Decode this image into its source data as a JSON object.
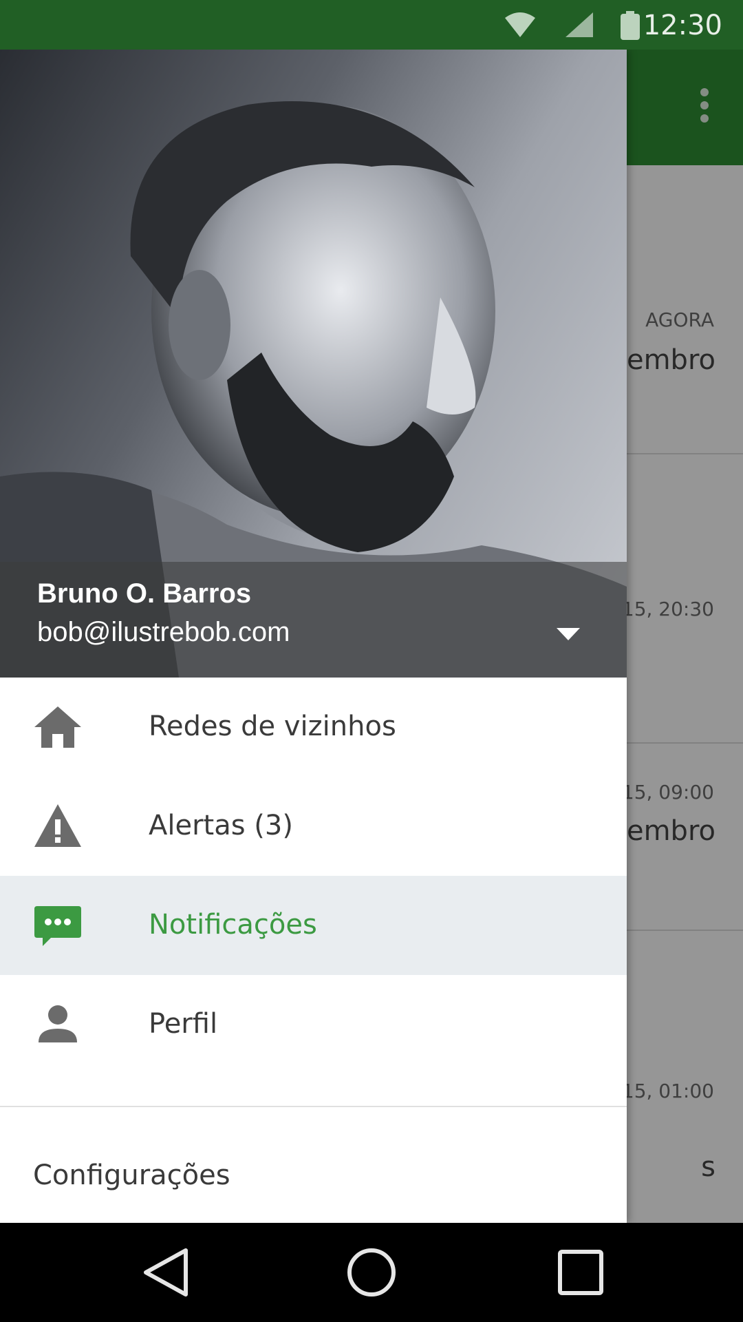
{
  "status_bar": {
    "time": "12:30",
    "icons": [
      "wifi-icon",
      "cell-signal-icon",
      "battery-icon"
    ]
  },
  "app": {
    "toolbar": {
      "menu_icon": "more-vert-icon"
    },
    "rows": [
      {
        "stamp": "AGORA",
        "line": "embro"
      },
      {
        "stamp": "15, 20:30",
        "line": ""
      },
      {
        "stamp": "15, 09:00",
        "line": "embro"
      },
      {
        "stamp": "15, 01:00",
        "line": "s"
      }
    ]
  },
  "drawer": {
    "user": {
      "name": "Bruno O. Barros",
      "email": "bob@ilustrebob.com"
    },
    "items": [
      {
        "label": "Redes de vizinhos",
        "icon": "home-icon",
        "active": false
      },
      {
        "label": "Alertas (3)",
        "icon": "warning-icon",
        "active": false
      },
      {
        "label": "Notificações",
        "icon": "chat-bubble-icon",
        "active": true
      },
      {
        "label": "Perfil",
        "icon": "person-icon",
        "active": false
      }
    ],
    "settings_label": "Configurações"
  },
  "colors": {
    "status_bar": "#215f25",
    "toolbar": "#2e8b32",
    "active_accent": "#3c9a42",
    "icon_grey": "#6b6b6b"
  },
  "nav_bar": {
    "buttons": [
      "back-icon",
      "home-circle-icon",
      "recents-icon"
    ]
  }
}
